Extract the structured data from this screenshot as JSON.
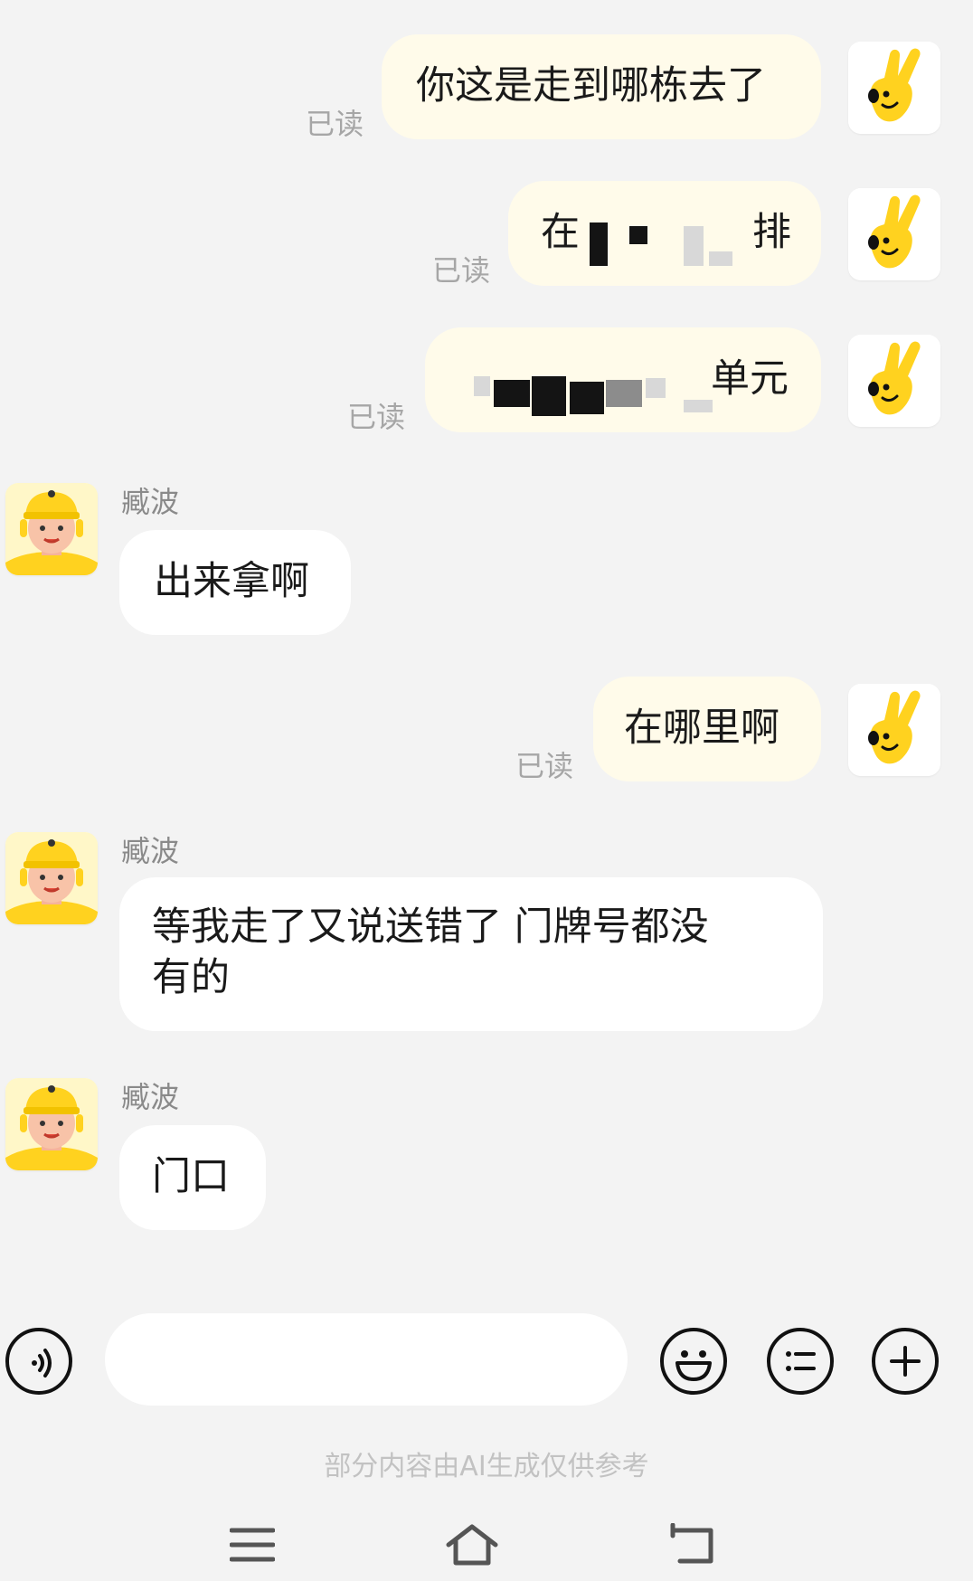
{
  "messages": [
    {
      "side": "mine",
      "text": "你这是走到哪栋去了",
      "read": "已读"
    },
    {
      "side": "mine",
      "text_prefix": "在",
      "text_suffix": "排",
      "read": "已读",
      "redacted": true
    },
    {
      "side": "mine",
      "text_suffix": "单元",
      "read": "已读",
      "redacted": true
    },
    {
      "side": "theirs",
      "sender": "臧波",
      "text": "出来拿啊"
    },
    {
      "side": "mine",
      "text": "在哪里啊",
      "read": "已读"
    },
    {
      "side": "theirs",
      "sender": "臧波",
      "line1": "等我走了又说送错了  门牌号都没",
      "line2": "有的"
    },
    {
      "side": "theirs",
      "sender": "臧波",
      "text": "门口"
    }
  ],
  "input": {
    "placeholder": ""
  },
  "toolbar": {
    "voice_icon": "voice-icon",
    "emoji_icon": "emoji-icon",
    "quick_reply_icon": "list-icon",
    "more_icon": "plus-icon"
  },
  "disclaimer": "部分内容由AI生成仅供参考",
  "nav": {
    "menu_icon": "menu-icon",
    "home_icon": "home-icon",
    "back_icon": "back-icon"
  },
  "colors": {
    "my_bubble": "#fffbea",
    "their_bubble": "#ffffff",
    "background": "#f3f3f3",
    "brand_yellow": "#ffd21f"
  }
}
